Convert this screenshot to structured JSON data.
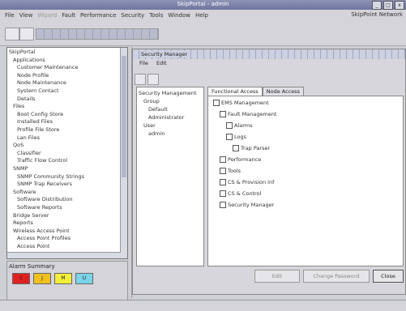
{
  "window": {
    "title": "SkipPortal - admin"
  },
  "window_controls": [
    "_",
    "□",
    "x"
  ],
  "menu": {
    "items": [
      {
        "label": "File",
        "disabled": false
      },
      {
        "label": "View",
        "disabled": false
      },
      {
        "label": "Wizard",
        "disabled": true
      },
      {
        "label": "Fault",
        "disabled": false
      },
      {
        "label": "Performance",
        "disabled": false
      },
      {
        "label": "Security",
        "disabled": false
      },
      {
        "label": "Tools",
        "disabled": false
      },
      {
        "label": "Window",
        "disabled": false
      },
      {
        "label": "Help",
        "disabled": false
      }
    ]
  },
  "brand": "SkipPoint Network",
  "left_tree": [
    {
      "label": "SkipPortal",
      "indent": 0
    },
    {
      "label": "Applications",
      "indent": 1
    },
    {
      "label": "Customer Maintenance",
      "indent": 2
    },
    {
      "label": "Node Profile",
      "indent": 2
    },
    {
      "label": "Node Maintenance",
      "indent": 2
    },
    {
      "label": "System Contact",
      "indent": 2
    },
    {
      "label": "Details",
      "indent": 2
    },
    {
      "label": "Files",
      "indent": 1
    },
    {
      "label": "Boot Config Store",
      "indent": 2
    },
    {
      "label": "Installed Files",
      "indent": 2
    },
    {
      "label": "Profile File Store",
      "indent": 2
    },
    {
      "label": "Lan Files",
      "indent": 2
    },
    {
      "label": "QoS",
      "indent": 1
    },
    {
      "label": "Classifier",
      "indent": 2
    },
    {
      "label": "Traffic Flow Control",
      "indent": 2
    },
    {
      "label": "SNMP",
      "indent": 1
    },
    {
      "label": "SNMP Community Strings",
      "indent": 2
    },
    {
      "label": "SNMP Trap Receivers",
      "indent": 2
    },
    {
      "label": "Software",
      "indent": 1
    },
    {
      "label": "Software Distribution",
      "indent": 2
    },
    {
      "label": "Software Reports",
      "indent": 2
    },
    {
      "label": "Bridge Server",
      "indent": 1
    },
    {
      "label": "Reports",
      "indent": 1
    },
    {
      "label": "Wireless Access Point",
      "indent": 1
    },
    {
      "label": "Access Point Profiles",
      "indent": 2
    },
    {
      "label": "Access Point",
      "indent": 2
    }
  ],
  "alarm": {
    "label": "Alarm Summary",
    "boxes": [
      {
        "label": "C",
        "color": "#e02020"
      },
      {
        "label": "J",
        "color": "#f0c020"
      },
      {
        "label": "M",
        "color": "#f2ee3a"
      },
      {
        "label": "U",
        "color": "#7ad4e8"
      }
    ]
  },
  "security": {
    "title": "Security Manager",
    "menu": [
      "File",
      "Edit"
    ],
    "tree": [
      {
        "label": "Security Management",
        "indent": 0
      },
      {
        "label": "Group",
        "indent": 1
      },
      {
        "label": "Default",
        "indent": 2
      },
      {
        "label": "Administrator",
        "indent": 2
      },
      {
        "label": "User",
        "indent": 1
      },
      {
        "label": "admin",
        "indent": 2
      }
    ],
    "tabs": [
      "Functional Access",
      "Node Access"
    ],
    "active_tab": 0,
    "perm_tree": [
      {
        "label": "EMS Management",
        "indent": 0
      },
      {
        "label": "Fault Management",
        "indent": 1
      },
      {
        "label": "Alarms",
        "indent": 2
      },
      {
        "label": "Logs",
        "indent": 2
      },
      {
        "label": "Trap Parser",
        "indent": 3
      },
      {
        "label": "Performance",
        "indent": 1
      },
      {
        "label": "Tools",
        "indent": 1
      },
      {
        "label": "CS & Provision inf",
        "indent": 1
      },
      {
        "label": "CS & Control",
        "indent": 1
      },
      {
        "label": "Security Manager",
        "indent": 1
      }
    ],
    "buttons": [
      {
        "label": "Edit",
        "enabled": false
      },
      {
        "label": "Change Password",
        "enabled": false
      },
      {
        "label": "Close",
        "enabled": true
      }
    ]
  }
}
